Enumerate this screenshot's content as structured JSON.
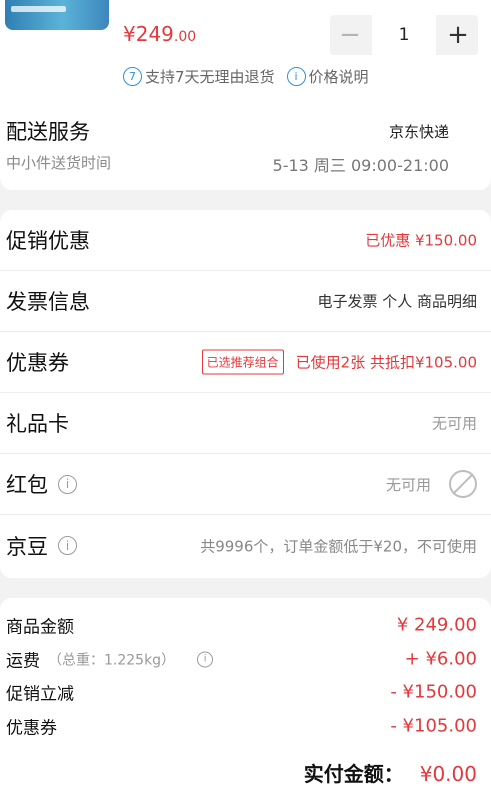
{
  "product": {
    "price_main": "¥249",
    "price_decimal": ".00",
    "quantity": "1",
    "minus_label": "−",
    "plus_label": "+",
    "promise_badge": "7",
    "promise_text": "支持7天无理由退货",
    "price_info_icon": "i",
    "price_info_text": "价格说明"
  },
  "shipping": {
    "title": "配送服务",
    "carrier": "京东快递",
    "subtitle": "中小件送货时间",
    "time": "5-13 周三 09:00-21:00"
  },
  "rows": [
    {
      "label": "促销优惠",
      "value": "已优惠 ¥150.00"
    },
    {
      "label": "发票信息",
      "value": "电子发票 个人 商品明细"
    },
    {
      "label": "优惠券",
      "tag": "已选推荐组合",
      "value": "已使用2张 共抵扣¥105.00"
    },
    {
      "label": "礼品卡",
      "value": "无可用"
    },
    {
      "label": "红包",
      "value": "无可用"
    },
    {
      "label": "京豆",
      "value": "共9996个，订单金额低于¥20，不可使用"
    }
  ],
  "summary": [
    {
      "label": "商品金额",
      "value": "¥ 249.00"
    },
    {
      "label": "运费",
      "note": "（总重：1.225kg）",
      "value": "+ ¥6.00"
    },
    {
      "label": "促销立减",
      "value": "- ¥150.00"
    },
    {
      "label": "优惠券",
      "value": "- ¥105.00"
    }
  ],
  "total": {
    "label": "实付金额：",
    "value": "¥0.00"
  },
  "icons": {
    "info": "i"
  },
  "colors": {
    "accent_red": "#e4393c",
    "info_blue": "#2f8fe0"
  }
}
